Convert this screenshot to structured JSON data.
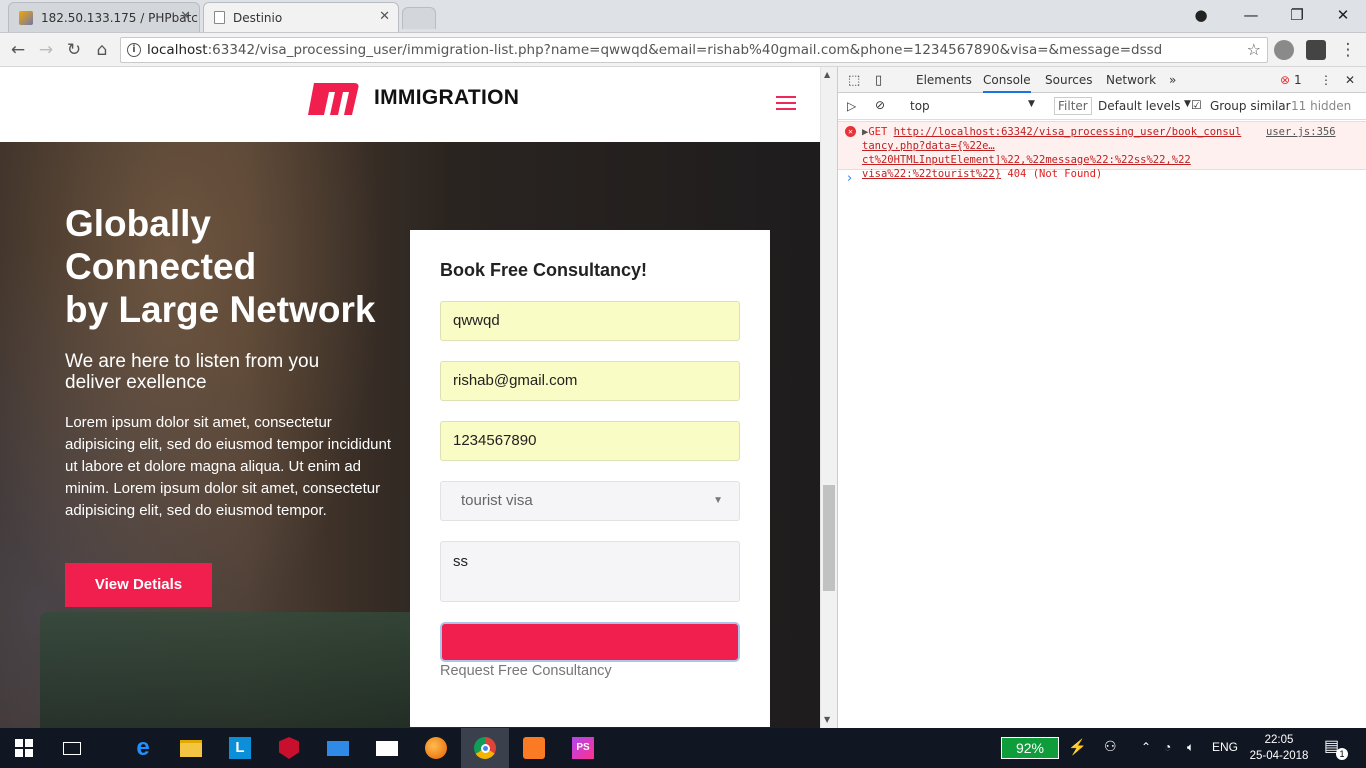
{
  "browser": {
    "tabs": [
      {
        "title": "182.50.133.175 / PHPbatc",
        "favicon": "phpmyadmin-icon"
      },
      {
        "title": "Destinio",
        "favicon": "page-icon"
      }
    ],
    "url_host": "localhost",
    "url_rest": ":63342/visa_processing_user/immigration-list.php?name=qwwqd&email=rishab%40gmail.com&phone=1234567890&visa=&message=dssd"
  },
  "site": {
    "brand": "IMMIGRATION",
    "brand_color": "#f01f4e",
    "hero": {
      "title_line1": "Globally",
      "title_line2": "Connected",
      "title_line3": "by Large Network",
      "subtitle_line1": "We are here to listen from you",
      "subtitle_line2": "deliver exellence",
      "body": "Lorem ipsum dolor sit amet, consectetur adipisicing elit, sed do eiusmod tempor incididunt ut labore et dolore magna aliqua. Ut enim ad minim. Lorem ipsum dolor sit amet, consectetur adipisicing elit, sed do eiusmod tempor.",
      "button": "View Detials"
    },
    "form": {
      "title": "Book Free Consultancy!",
      "name": "qwwqd",
      "email": "rishab@gmail.com",
      "phone": "1234567890",
      "visa": "tourist visa",
      "message": "ss",
      "submit_label": "Request Free Consultancy"
    }
  },
  "devtools": {
    "tabs": [
      "Elements",
      "Console",
      "Sources",
      "Network"
    ],
    "error_count": "1",
    "context": "top",
    "filter_placeholder": "Filter",
    "levels": "Default levels",
    "group_similar": "Group similar",
    "hidden": "11 hidden",
    "error": {
      "method": "GET",
      "line1": "http://localhost:63342/visa_processing_user/book_consul",
      "line2": "tancy.php?data={%22e…ct%20HTMLInputElement]%22,%22message%22:%22ss%22,%22",
      "line3": "visa%22:%22tourist%22}",
      "status": "404 (Not Found)",
      "source": "user.js:356"
    }
  },
  "taskbar": {
    "battery": "92%",
    "language": "ENG",
    "time": "22:05",
    "date": "25-04-2018",
    "notifications": "1"
  }
}
